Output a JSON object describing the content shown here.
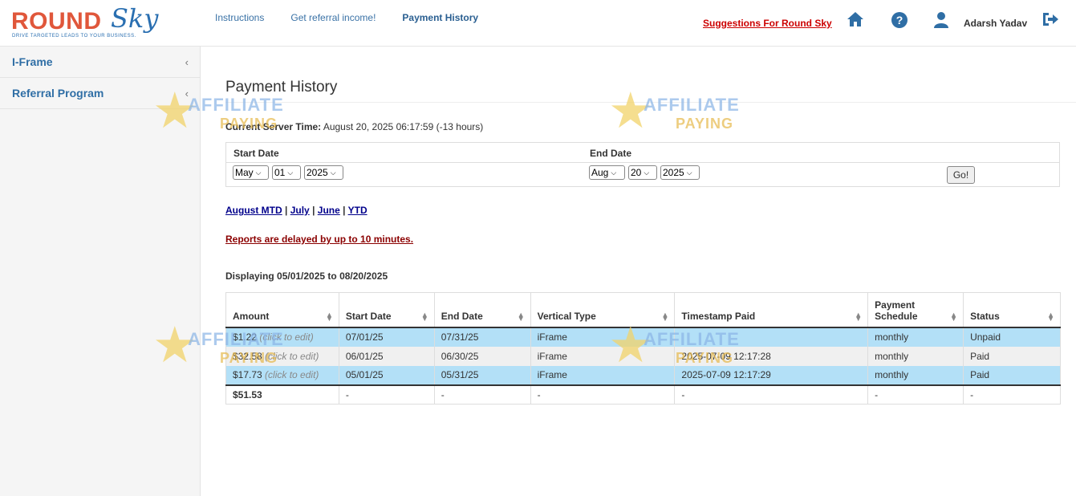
{
  "brand": {
    "name_part1": "ROUND",
    "name_part2": "Sky",
    "tagline": "DRIVE TARGETED LEADS TO YOUR BUSINESS."
  },
  "topnav": [
    {
      "label": "Instructions"
    },
    {
      "label": "Get referral income!"
    },
    {
      "label": "Payment History"
    }
  ],
  "header": {
    "suggestions": "Suggestions For Round Sky",
    "username": "Adarsh Yadav",
    "icons": [
      "home-icon",
      "help-icon",
      "user-icon",
      "logout-icon"
    ]
  },
  "sidebar": {
    "items": [
      {
        "label": "I-Frame"
      },
      {
        "label": "Referral Program"
      }
    ]
  },
  "page": {
    "title": "Payment History",
    "server_time_label": "Current Server Time:",
    "server_time_value": "August 20, 2025 06:17:59 (-13 hours)"
  },
  "date_range": {
    "start_label": "Start Date",
    "end_label": "End Date",
    "start": {
      "month": "May",
      "day": "01",
      "year": "2025"
    },
    "end": {
      "month": "Aug",
      "day": "20",
      "year": "2025"
    },
    "go_label": "Go!"
  },
  "quick_links": [
    "August MTD",
    "July",
    "June",
    "YTD"
  ],
  "quick_sep": "|",
  "delay_notice": "Reports are delayed by up to 10 minutes.",
  "displaying": "Displaying 05/01/2025 to 08/20/2025",
  "table": {
    "headers": [
      "Amount",
      "Start Date",
      "End Date",
      "Vertical Type",
      "Timestamp Paid",
      "Payment Schedule",
      "Status"
    ],
    "edit_hint": "(click to edit)",
    "rows": [
      {
        "amount": "$1.22",
        "start": "07/01/25",
        "end": "07/31/25",
        "vertical": "iFrame",
        "paid": "",
        "schedule": "monthly",
        "status": "Unpaid"
      },
      {
        "amount": "$32.58",
        "start": "06/01/25",
        "end": "06/30/25",
        "vertical": "iFrame",
        "paid": "2025-07-09 12:17:28",
        "schedule": "monthly",
        "status": "Paid"
      },
      {
        "amount": "$17.73",
        "start": "05/01/25",
        "end": "05/31/25",
        "vertical": "iFrame",
        "paid": "2025-07-09 12:17:29",
        "schedule": "monthly",
        "status": "Paid"
      }
    ],
    "total": {
      "amount": "$51.53",
      "start": "-",
      "end": "-",
      "vertical": "-",
      "paid": "-",
      "schedule": "-",
      "status": "-"
    }
  },
  "watermark": {
    "line1": "AFFILIATE",
    "line2": "PAYING"
  },
  "colors": {
    "brand_red": "#e0573b",
    "brand_blue": "#2a6fb1",
    "row_highlight": "#b3e0f7",
    "link_blue": "#3a72a6",
    "warning_red": "#8b0000"
  }
}
